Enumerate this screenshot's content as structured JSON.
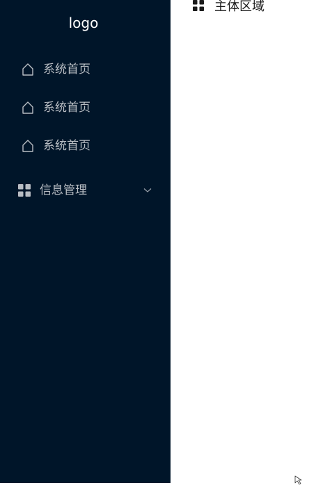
{
  "sidebar": {
    "logo": "logo",
    "items": [
      {
        "label": "系统首页",
        "icon": "home-icon"
      },
      {
        "label": "系统首页",
        "icon": "home-icon"
      },
      {
        "label": "系统首页",
        "icon": "home-icon"
      }
    ],
    "submenu": {
      "label": "信息管理",
      "icon": "appstore-icon",
      "expand_icon": "chevron-down-icon"
    }
  },
  "main": {
    "title": "主体区域",
    "title_icon": "appstore-icon"
  },
  "colors": {
    "sidebar_bg": "#001529",
    "menu_text": "rgba(255,255,255,0.72)",
    "main_bg": "#ffffff"
  }
}
